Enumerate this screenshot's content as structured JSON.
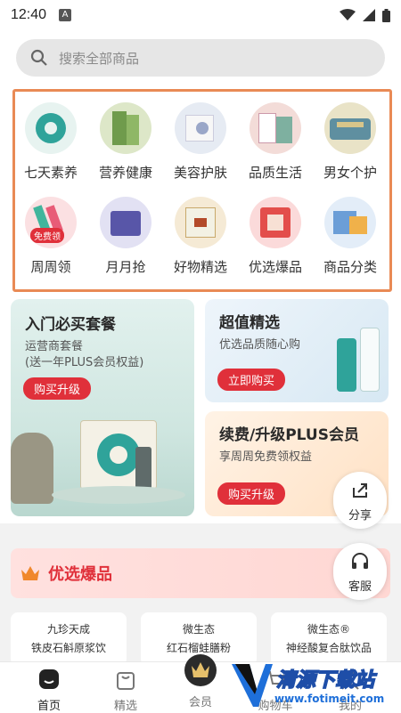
{
  "status_bar": {
    "time": "12:40",
    "notif_letter": "A"
  },
  "search": {
    "placeholder": "搜索全部商品"
  },
  "categories": [
    {
      "label": "七天素养"
    },
    {
      "label": "营养健康"
    },
    {
      "label": "美容护肤"
    },
    {
      "label": "品质生活"
    },
    {
      "label": "男女个护"
    },
    {
      "label": "周周领",
      "tag": "免费领"
    },
    {
      "label": "月月抢"
    },
    {
      "label": "好物精选"
    },
    {
      "label": "优选爆品"
    },
    {
      "label": "商品分类"
    }
  ],
  "promo_left": {
    "title": "入门必买套餐",
    "line1": "运营商套餐",
    "line2": "(送一年PLUS会员权益)",
    "button": "购买升级"
  },
  "promo_right_top": {
    "title": "超值精选",
    "sub": "优选品质随心购",
    "button": "立即购买"
  },
  "promo_right_bottom": {
    "title": "续费/升级PLUS会员",
    "sub": "享周周免费领权益",
    "button": "购买升级"
  },
  "share": {
    "label": "分享"
  },
  "service": {
    "label": "客服"
  },
  "hot_section": {
    "title": "优选爆品"
  },
  "products": [
    {
      "brand": "九珍天成",
      "name": "铁皮石斛原浆饮"
    },
    {
      "brand": "微生态",
      "name": "红石榴蛙膳粉"
    },
    {
      "brand": "微生态®",
      "name": "神经酸复合肽饮品"
    }
  ],
  "tabbar": [
    {
      "label": "首页"
    },
    {
      "label": "精选"
    },
    {
      "label": "会员"
    },
    {
      "label": "购物车"
    },
    {
      "label": "我的"
    }
  ],
  "watermark": {
    "cn": "清源下载站",
    "url": "www.fotimeit.com"
  },
  "colors": {
    "accent": "#e0303a",
    "highlight_border": "#e98a55",
    "teal": "#2fa39a"
  }
}
